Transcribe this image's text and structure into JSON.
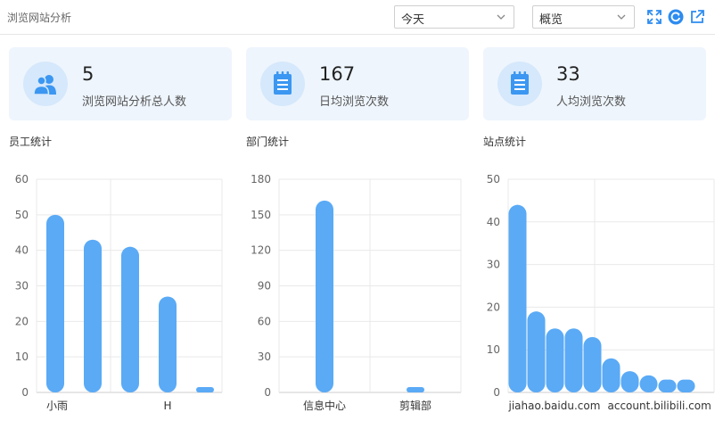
{
  "header": {
    "title": "浏览网站分析"
  },
  "filters": {
    "period": "今天",
    "view": "概览"
  },
  "toolbar": {
    "icons": [
      "fullscreen-icon",
      "refresh-icon",
      "export-icon"
    ],
    "accent": "#2d8cf0"
  },
  "stats": [
    {
      "value": "5",
      "label": "浏览网站分析总人数",
      "icon": "users-icon"
    },
    {
      "value": "167",
      "label": "日均浏览次数",
      "icon": "notepad-icon"
    },
    {
      "value": "33",
      "label": "人均浏览次数",
      "icon": "notepad-icon"
    }
  ],
  "colors": {
    "bar": "#5aaaf6",
    "card_bg": "#eef5fd",
    "badge_bg": "#d6e8fb",
    "icon": "#3b97f1"
  },
  "sections": {
    "staff": "员工统计",
    "dept": "部门统计",
    "site": "站点统计"
  },
  "chart_data": [
    {
      "type": "bar",
      "categories": [
        "小雨",
        "",
        "",
        "H",
        ""
      ],
      "values": [
        50,
        43,
        41,
        27,
        1.5
      ],
      "ylim": [
        0,
        60
      ],
      "yticks": [
        0,
        10,
        20,
        30,
        40,
        50,
        60
      ],
      "grid": true
    },
    {
      "type": "bar",
      "categories": [
        "信息中心",
        "剪辑部"
      ],
      "values": [
        162,
        2
      ],
      "ylim": [
        0,
        180
      ],
      "yticks": [
        0,
        30,
        60,
        90,
        120,
        150,
        180
      ],
      "grid": true
    },
    {
      "type": "bar",
      "categories": [
        "jiahao.baidu.com",
        "",
        "",
        "",
        "",
        "",
        "",
        "",
        "",
        "account.bilibili.com"
      ],
      "values": [
        44,
        19,
        15,
        15,
        13,
        8,
        5,
        4,
        3,
        3
      ],
      "ylim": [
        0,
        50
      ],
      "yticks": [
        0,
        10,
        20,
        30,
        40,
        50
      ],
      "grid": true
    }
  ]
}
